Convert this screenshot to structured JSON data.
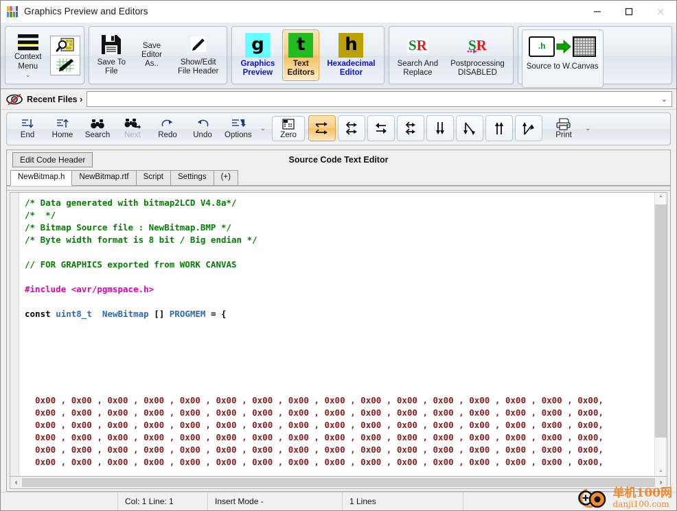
{
  "window": {
    "title": "Graphics Preview and Editors",
    "icon": "app-squares-icon",
    "icon_colors": [
      "#e8c000",
      "#e85aa8",
      "#d8d8d8",
      "#7a3fb8",
      "#3a9ad9",
      "#8a8a00",
      "#3ab54a",
      "#2a6fd8"
    ],
    "minimize": "—",
    "maximize": "□",
    "close": "✕"
  },
  "ribbon": {
    "context": {
      "label": "Context\nMenu",
      "caret": "⌄"
    },
    "icon_tile": {
      "top": "magnifier-canvas-icon",
      "bottom": "pen-canvas-icon"
    },
    "groups": [
      {
        "name": "file",
        "buttons": [
          {
            "name": "save-to-file",
            "label": "Save To\nFile",
            "icon": "floppy-icon"
          },
          {
            "name": "save-editor-as",
            "label": "Save\nEditor\nAs..",
            "icon": ""
          },
          {
            "name": "show-edit-file-header",
            "label": "Show/Edit\nFile Header",
            "icon": "pencil-icon"
          }
        ]
      },
      {
        "name": "editors",
        "buttons": [
          {
            "name": "graphics-preview",
            "label": "Graphics\nPreview",
            "glyph": "g",
            "glyph_bg": "#66ffff",
            "selected": false
          },
          {
            "name": "text-editors",
            "label": "Text\nEditors",
            "glyph": "t",
            "glyph_bg": "#22bb22",
            "selected": true
          },
          {
            "name": "hexadecimal-editor",
            "label": "Hexadecimal\nEditor",
            "glyph": "h",
            "glyph_bg": "#bba200",
            "selected": false
          }
        ]
      },
      {
        "name": "tools",
        "buttons": [
          {
            "name": "search-and-replace",
            "label": "Search And\nReplace",
            "icon": "sr-icon"
          },
          {
            "name": "postprocessing",
            "label": "Postprocessing\nDISABLED",
            "icon": "sr-dotted-icon"
          }
        ]
      },
      {
        "name": "convert",
        "buttons": [
          {
            "name": "source-to-wcanvas",
            "label": "Source to W.Canvas",
            "icon": "h-to-grid-icon",
            "file_ext": ".h"
          }
        ]
      }
    ]
  },
  "recent": {
    "eye_icon": "eye-crossed-icon",
    "label": "Recent Files ›",
    "combo_value": "",
    "combo_caret": "⌄"
  },
  "edtoolbar": {
    "buttons": [
      {
        "name": "end",
        "label": "End",
        "icon": "goto-end-icon"
      },
      {
        "name": "home",
        "label": "Home",
        "icon": "goto-home-icon"
      },
      {
        "name": "search",
        "label": "Search",
        "icon": "binoculars-icon"
      },
      {
        "name": "next",
        "label": "Next",
        "icon": "binoculars-next-icon",
        "disabled": true
      },
      {
        "name": "redo",
        "label": "Redo",
        "icon": "redo-arrow-icon"
      },
      {
        "name": "undo",
        "label": "Undo",
        "icon": "undo-arrow-icon"
      },
      {
        "name": "options",
        "label": "Options",
        "icon": "options-icon"
      }
    ],
    "options_caret": "⌄",
    "zero": {
      "name": "zero",
      "label": "Zero",
      "icon": "zero-grid-icon"
    },
    "sort_buttons": [
      {
        "name": "sort-1",
        "icon": "swap-rows-icon",
        "selected": true
      },
      {
        "name": "sort-2",
        "icon": "mirror-rows-icon",
        "selected": false
      },
      {
        "name": "sort-3",
        "icon": "flip-horizontal-icon",
        "selected": false
      },
      {
        "name": "sort-4",
        "icon": "rotate-rows-icon",
        "selected": false
      },
      {
        "name": "sort-5",
        "icon": "down-down-icon",
        "selected": false
      },
      {
        "name": "sort-6",
        "icon": "down-cross-icon",
        "selected": false
      },
      {
        "name": "sort-7",
        "icon": "up-up-icon",
        "selected": false
      },
      {
        "name": "sort-8",
        "icon": "up-cross-icon",
        "selected": false
      }
    ],
    "print": {
      "name": "print",
      "label": "Print",
      "icon": "printer-icon",
      "caret": "⌄"
    }
  },
  "panel": {
    "edit_code_header": "Edit Code Header",
    "title": "Source Code Text Editor",
    "tabs": [
      {
        "label": "NewBitmap.h",
        "active": true
      },
      {
        "label": "NewBitmap.rtf",
        "active": false
      },
      {
        "label": "Script",
        "active": false
      },
      {
        "label": "Settings",
        "active": false
      },
      {
        "label": "(+)",
        "active": false
      }
    ]
  },
  "code": {
    "lines": [
      {
        "text": "/* Data generated with bitmap2LCD V4.8a*/",
        "cls": "c-com"
      },
      {
        "text": "/*  */",
        "cls": "c-com"
      },
      {
        "text": "/* Bitmap Source file : NewBitmap.BMP */",
        "cls": "c-com"
      },
      {
        "text": "/* Byte width format is 8 bit / Big endian */",
        "cls": "c-com"
      },
      {
        "text": "",
        "cls": "c-plain"
      },
      {
        "text": "// FOR GRAPHICS exported from WORK CANVAS",
        "cls": "c-com"
      },
      {
        "text": "",
        "cls": "c-plain"
      },
      {
        "text": "#include <avr/pgmspace.h>",
        "cls": "c-pre"
      },
      {
        "text": "",
        "cls": "c-plain"
      },
      {
        "text": "const uint8_t  NewBitmap [] PROGMEM = {",
        "cls": "c-decl"
      }
    ],
    "hex_value": "0x00",
    "hex_separator": " , ",
    "hex_line_end": ",",
    "hex_per_line": 16,
    "hex_lines": 6,
    "blank_gap_lines": 6
  },
  "scroll": {
    "v_up": "⌃",
    "v_down": "⌄",
    "h_left": "‹",
    "h_right": "›"
  },
  "status": {
    "blank": "",
    "position": "Col: 1 Line: 1",
    "mode": "Insert Mode -",
    "lines": "1 Lines",
    "extra": ""
  },
  "watermark": {
    "line1": "单机100网",
    "line2": "danji100.com",
    "color": "#f08a2a"
  }
}
